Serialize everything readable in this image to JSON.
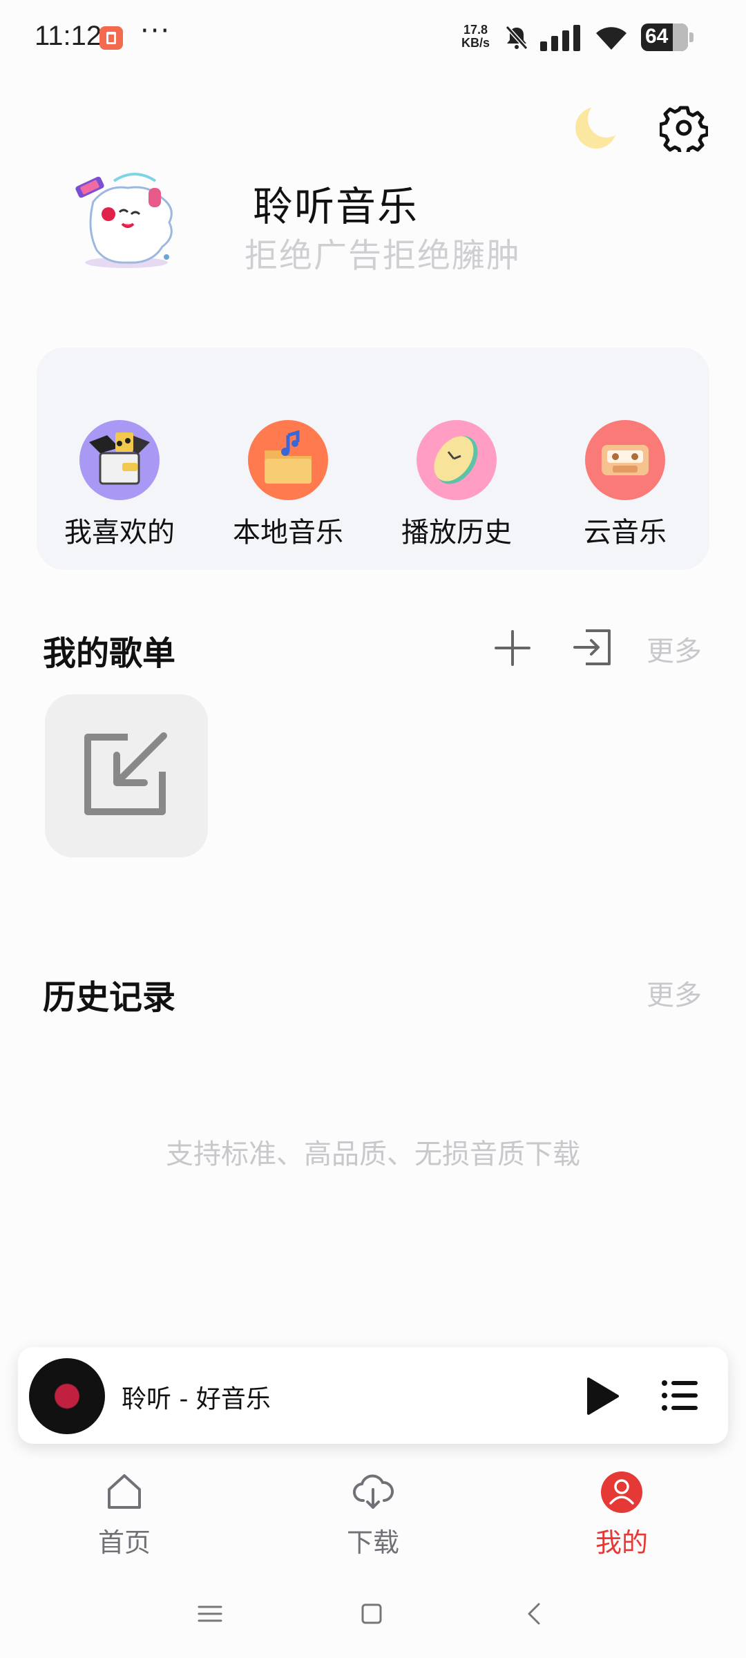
{
  "status_bar": {
    "time": "11:12",
    "dots": "···",
    "net_speed_value": "17.8",
    "net_speed_unit": "KB/s",
    "battery": "64"
  },
  "header": {
    "app_title": "聆听音乐",
    "app_subtitle": "拒绝广告拒绝臃肿"
  },
  "quick_access": [
    {
      "label": "我喜欢的",
      "icon": "heart-box-icon",
      "color": "#a999f4"
    },
    {
      "label": "本地音乐",
      "icon": "folder-music-icon",
      "color": "#ff7b4f"
    },
    {
      "label": "播放历史",
      "icon": "clock-icon",
      "color": "#ff9ec2"
    },
    {
      "label": "云音乐",
      "icon": "cassette-icon",
      "color": "#fa7a78"
    }
  ],
  "playlists": {
    "title": "我的歌单",
    "more": "更多"
  },
  "history": {
    "title": "历史记录",
    "more": "更多",
    "empty_hint": "支持标准、高品质、无损音质下载"
  },
  "player": {
    "title": "聆听 - 好音乐"
  },
  "bottom_nav": [
    {
      "label": "首页",
      "icon": "home-icon",
      "active": false
    },
    {
      "label": "下载",
      "icon": "cloud-download-icon",
      "active": false
    },
    {
      "label": "我的",
      "icon": "profile-icon",
      "active": true
    }
  ],
  "colors": {
    "accent": "#e53935",
    "muted_text": "#c8c8cc",
    "card_bg": "#f4f5f9"
  }
}
